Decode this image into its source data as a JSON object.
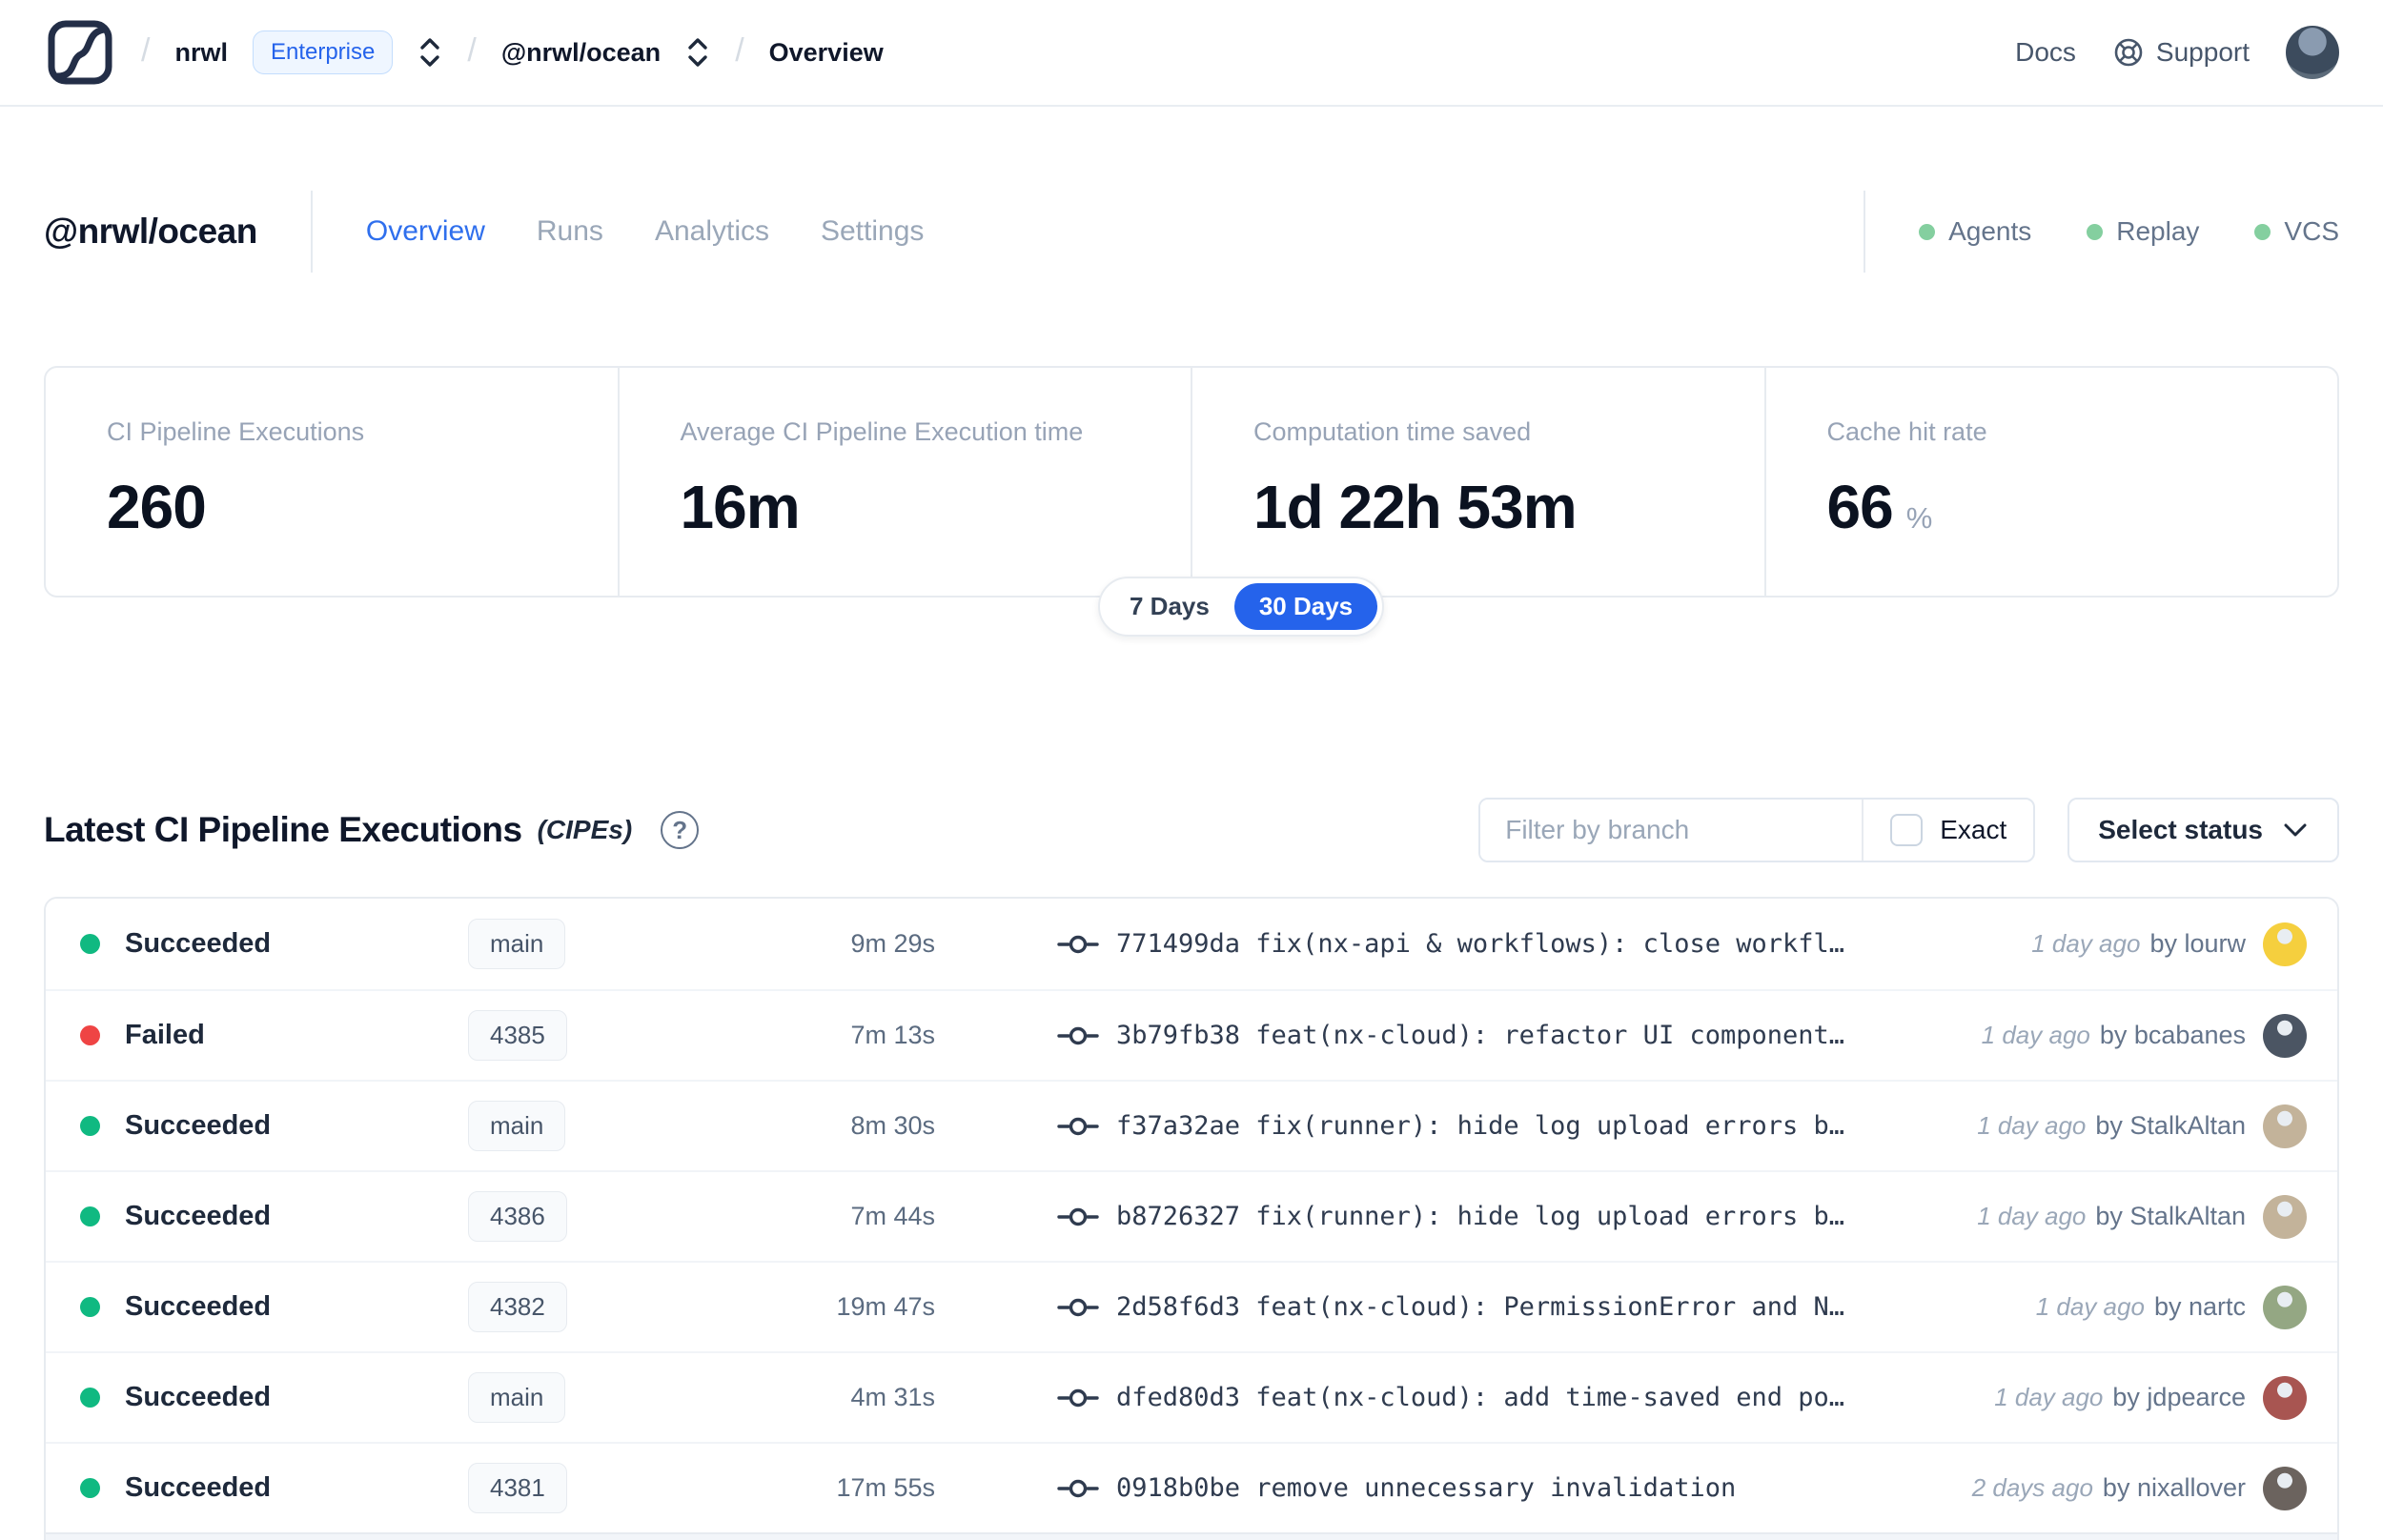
{
  "colors": {
    "accent": "#2563eb",
    "status": {
      "succeeded": "#10b981",
      "failed": "#ef4444"
    },
    "feature_dot": "#84cf9f"
  },
  "navbar": {
    "logo": "nx-cloud-logo",
    "breadcrumb": {
      "org": "nrwl",
      "org_badge": "Enterprise",
      "workspace": "@nrwl/ocean",
      "page": "Overview"
    },
    "docs_label": "Docs",
    "support_label": "Support"
  },
  "header": {
    "title": "@nrwl/ocean",
    "tabs": [
      {
        "label": "Overview",
        "active": true
      },
      {
        "label": "Runs",
        "active": false
      },
      {
        "label": "Analytics",
        "active": false
      },
      {
        "label": "Settings",
        "active": false
      }
    ],
    "features": [
      {
        "label": "Agents"
      },
      {
        "label": "Replay"
      },
      {
        "label": "VCS"
      }
    ]
  },
  "stats": {
    "cards": [
      {
        "label": "CI Pipeline Executions",
        "value": "260"
      },
      {
        "label": "Average CI Pipeline Execution time",
        "value": "16m"
      },
      {
        "label": "Computation time saved",
        "value": "1d 22h 53m"
      },
      {
        "label": "Cache hit rate",
        "value": "66",
        "suffix": "%"
      }
    ],
    "range_toggle": {
      "options": [
        "7 Days",
        "30 Days"
      ],
      "selected": "30 Days"
    }
  },
  "section": {
    "title": "Latest CI Pipeline Executions",
    "subtitle": "(CIPEs)",
    "help_glyph": "?",
    "filter_placeholder": "Filter by branch",
    "exact_label": "Exact",
    "status_button_label": "Select status"
  },
  "table": {
    "rows": [
      {
        "state": "succeeded",
        "status": "Succeeded",
        "branch": "main",
        "duration": "9m 29s",
        "commit": "771499da fix(nx-api & workflows): close workfl…",
        "time": "1 day ago",
        "author": "by lourw",
        "avatar_color": "#f5cf3e"
      },
      {
        "state": "failed",
        "status": "Failed",
        "branch": "4385",
        "duration": "7m 13s",
        "commit": "3b79fb38 feat(nx-cloud): refactor UI component…",
        "time": "1 day ago",
        "author": "by bcabanes",
        "avatar_color": "#4b5563"
      },
      {
        "state": "succeeded",
        "status": "Succeeded",
        "branch": "main",
        "duration": "8m 30s",
        "commit": "f37a32ae fix(runner): hide log upload errors b…",
        "time": "1 day ago",
        "author": "by StalkAltan",
        "avatar_color": "#c3b39a"
      },
      {
        "state": "succeeded",
        "status": "Succeeded",
        "branch": "4386",
        "duration": "7m 44s",
        "commit": "b8726327 fix(runner): hide log upload errors b…",
        "time": "1 day ago",
        "author": "by StalkAltan",
        "avatar_color": "#c3b39a"
      },
      {
        "state": "succeeded",
        "status": "Succeeded",
        "branch": "4382",
        "duration": "19m 47s",
        "commit": "2d58f6d3 feat(nx-cloud): PermissionError and N…",
        "time": "1 day ago",
        "author": "by nartc",
        "avatar_color": "#94a783"
      },
      {
        "state": "succeeded",
        "status": "Succeeded",
        "branch": "main",
        "duration": "4m 31s",
        "commit": "dfed80d3 feat(nx-cloud): add time-saved end po…",
        "time": "1 day ago",
        "author": "by jdpearce",
        "avatar_color": "#a85551"
      },
      {
        "state": "succeeded",
        "status": "Succeeded",
        "branch": "4381",
        "duration": "17m 55s",
        "commit": "0918b0be remove unnecessary invalidation",
        "time": "2 days ago",
        "author": "by nixallover",
        "avatar_color": "#6b635e"
      }
    ]
  }
}
